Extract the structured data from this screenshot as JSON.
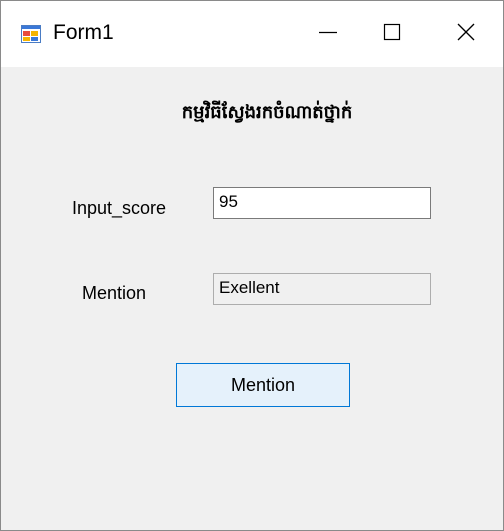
{
  "window": {
    "title": "Form1",
    "icon": "winforms-app-icon",
    "controls": {
      "minimize_icon": "minimize-icon",
      "maximize_icon": "maximize-icon",
      "close_icon": "close-icon"
    }
  },
  "form": {
    "heading": "កម្មវិធីស្វែងរកចំណាត់ថ្នាក់",
    "score_label": "Input_score",
    "score_value": "95",
    "mention_label": "Mention",
    "mention_value": "Exellent",
    "button_label": "Mention"
  },
  "colors": {
    "client_background": "#f0f0f0",
    "button_background": "#e5f1fb",
    "button_border": "#0078d7"
  }
}
